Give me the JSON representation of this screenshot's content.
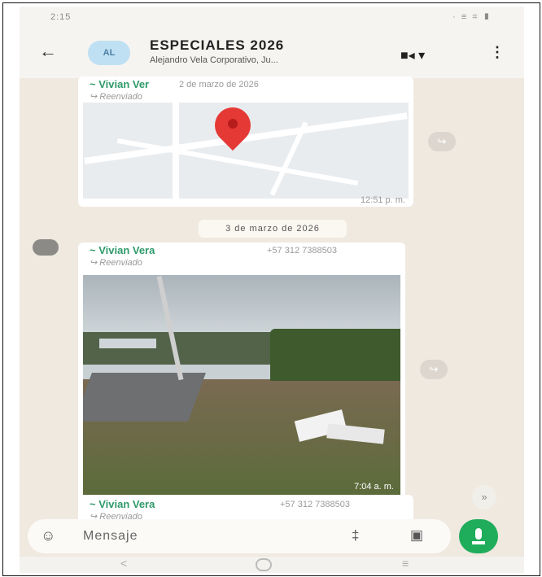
{
  "status_bar": {
    "time": "2:15",
    "right_icons": "· ≡ ⌗ ▮"
  },
  "header": {
    "back_icon": "←",
    "avatar_text": "AL",
    "title": "ESPECIALES 2026",
    "subtitle": "Alejandro Vela Corporativo, Ju...",
    "video_icon": "■◂ ▾",
    "menu_icon": "⋮"
  },
  "messages": [
    {
      "sender": "~ Vivian Ver",
      "meta": "2 de marzo de 2026",
      "forwarded": "↪ Reenviado",
      "time": "12:51 p. m."
    },
    {
      "date_chip": "3 de marzo de 2026",
      "sender": "~ Vivian Vera",
      "phone": "+57 312 7388503",
      "forwarded": "↪ Reenviado",
      "time": "7:04 a. m."
    },
    {
      "sender": "~ Vivian Vera",
      "phone": "+57 312 7388503",
      "forwarded": "↪ Reenviado"
    }
  ],
  "composer": {
    "placeholder": "Mensaje",
    "emoji_icon": "☺",
    "attach_icon": "‡",
    "camera_icon": "▣"
  },
  "scroll_icon": "»",
  "share_icon": "↪",
  "nav": {
    "back": "<",
    "recent": "≡"
  },
  "colors": {
    "accent": "#1fad5b",
    "sender": "#2f9a6a",
    "background": "#efe9e0"
  }
}
